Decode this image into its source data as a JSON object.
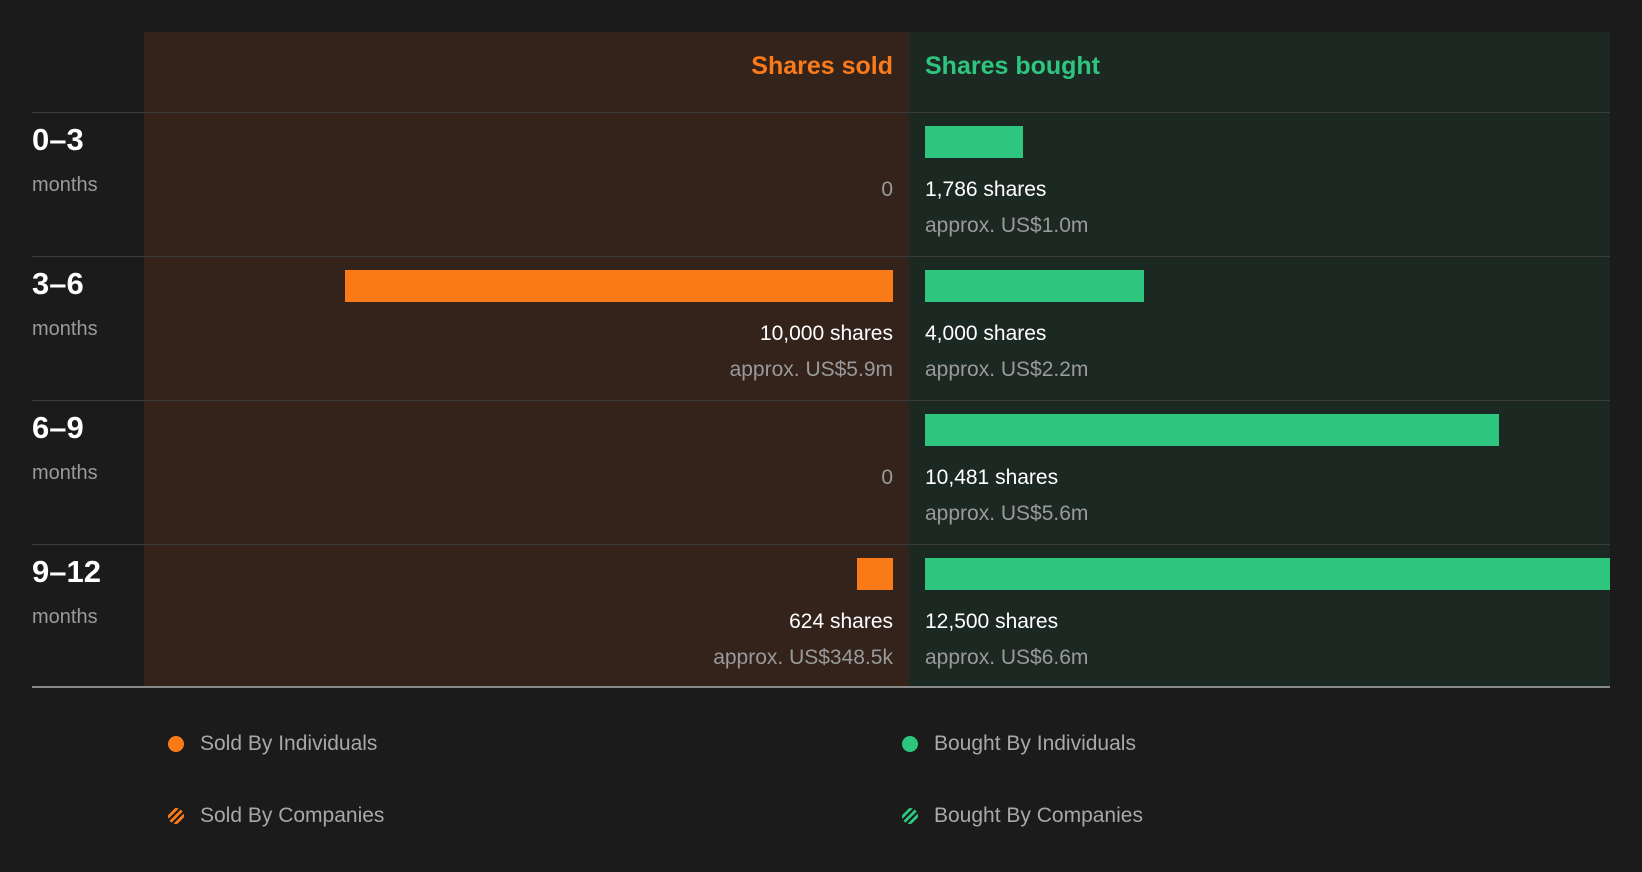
{
  "chart_data": {
    "type": "bar",
    "headers": {
      "sold": "Shares sold",
      "bought": "Shares bought"
    },
    "categories": [
      {
        "period": "0–3",
        "unit": "months"
      },
      {
        "period": "3–6",
        "unit": "months"
      },
      {
        "period": "6–9",
        "unit": "months"
      },
      {
        "period": "9–12",
        "unit": "months"
      }
    ],
    "series": [
      {
        "name": "Shares sold",
        "values": [
          0,
          10000,
          0,
          624
        ],
        "labels": [
          "0",
          "10,000 shares",
          "0",
          "624 shares"
        ],
        "approx": [
          "",
          "approx. US$5.9m",
          "",
          "approx. US$348.5k"
        ]
      },
      {
        "name": "Shares bought",
        "values": [
          1786,
          4000,
          10481,
          12500
        ],
        "labels": [
          "1,786 shares",
          "4,000 shares",
          "10,481 shares",
          "12,500 shares"
        ],
        "approx": [
          "approx. US$1.0m",
          "approx. US$2.2m",
          "approx. US$5.6m",
          "approx. US$6.6m"
        ]
      }
    ],
    "legend": [
      {
        "label": "Sold By Individuals",
        "style": "solid",
        "color": "#fb7a18"
      },
      {
        "label": "Bought By Individuals",
        "style": "solid",
        "color": "#2ec67e"
      },
      {
        "label": "Sold By Companies",
        "style": "striped",
        "color": "#fb7a18"
      },
      {
        "label": "Bought By Companies",
        "style": "striped",
        "color": "#2ec67e"
      }
    ],
    "colors": {
      "sold": "#fb7a18",
      "bought": "#2ec67e",
      "sold_bg": "#33231b",
      "bought_bg": "#1c2822"
    }
  }
}
